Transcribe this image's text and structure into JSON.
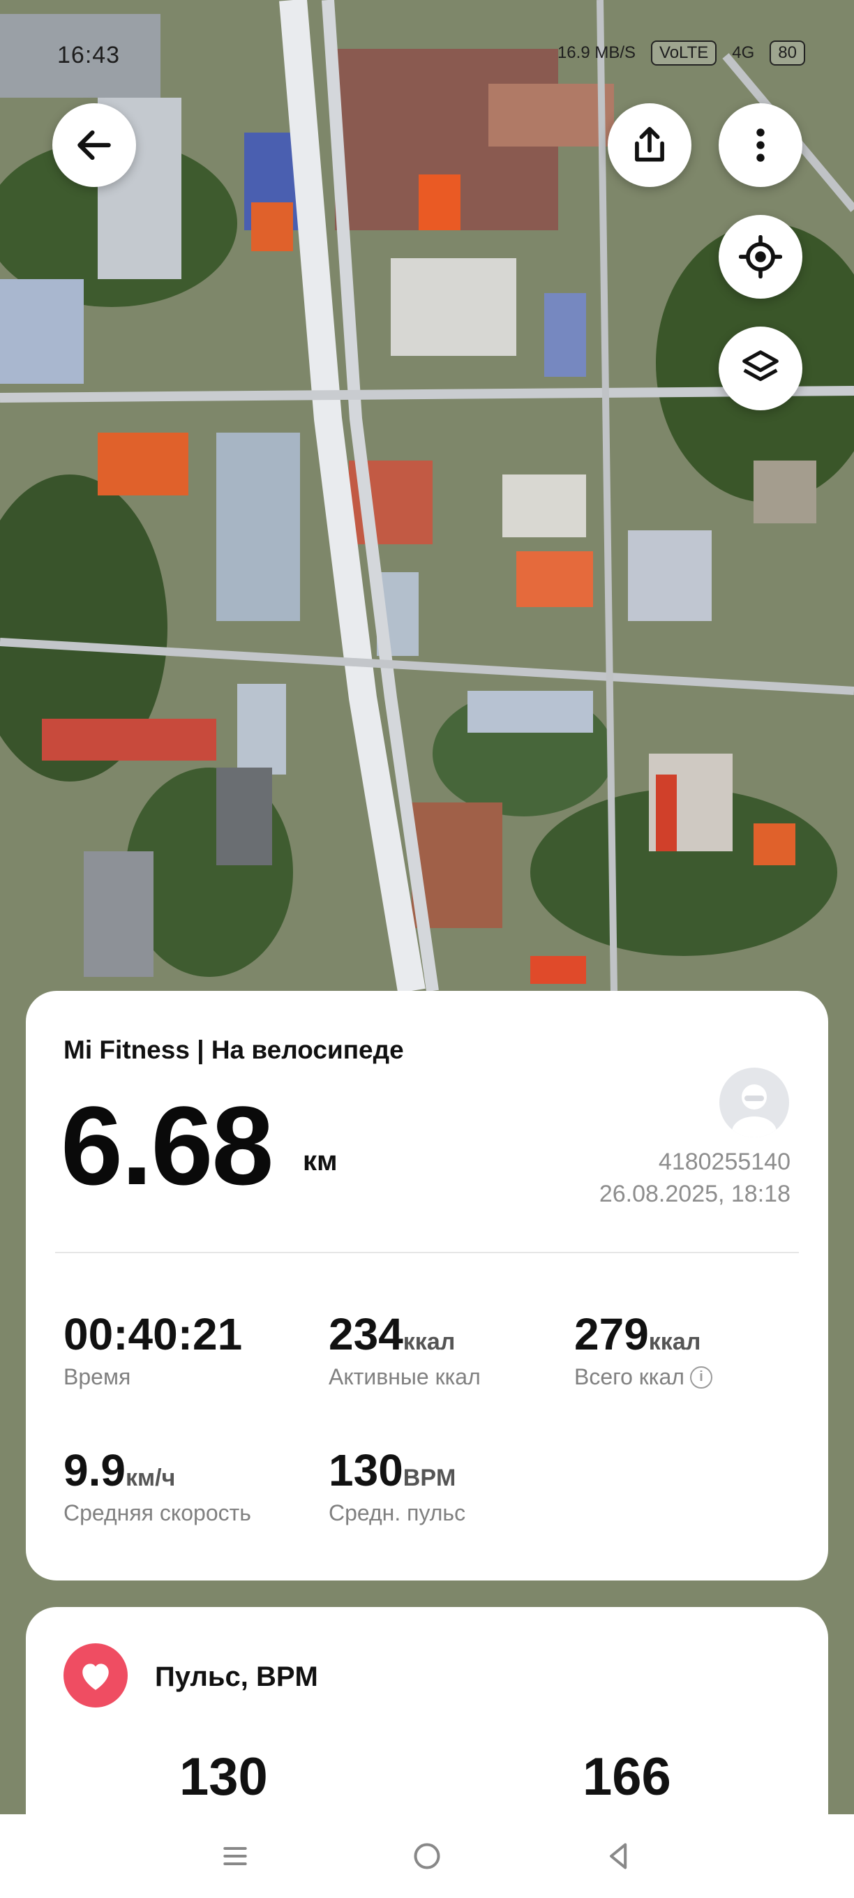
{
  "status_bar": {
    "time": "16:43",
    "network_speed": "16.9 MB/S",
    "carrier": "VoLTE",
    "signal": "4G",
    "battery": "80"
  },
  "map": {
    "buttons": {
      "back": "arrow-left-icon",
      "share": "share-icon",
      "more": "more-vertical-icon",
      "locate": "crosshair-icon",
      "layers": "layers-icon"
    }
  },
  "summary": {
    "source_title": "Mi Fitness | На велосипеде",
    "distance_value": "6.68",
    "distance_unit": "км",
    "user_id": "4180255140",
    "datetime": "26.08.2025, 18:18",
    "stats": [
      {
        "value": "00:40:21",
        "unit": "",
        "label": "Время"
      },
      {
        "value": "234",
        "unit": "ккал",
        "label": "Активные ккал"
      },
      {
        "value": "279",
        "unit": "ккал",
        "label": "Всего ккал"
      },
      {
        "value": "9.9",
        "unit": "км/ч",
        "label": "Средняя скорость"
      },
      {
        "value": "130",
        "unit": "BPM",
        "label": "Средн. пульс"
      }
    ]
  },
  "pulse": {
    "title": "Пульс, BPM",
    "avg_value": "130",
    "max_value": "166",
    "accent_color": "#ef4d62"
  },
  "navbar": {
    "buttons": [
      "menu-icon",
      "home-icon",
      "back-triangle-icon"
    ]
  }
}
